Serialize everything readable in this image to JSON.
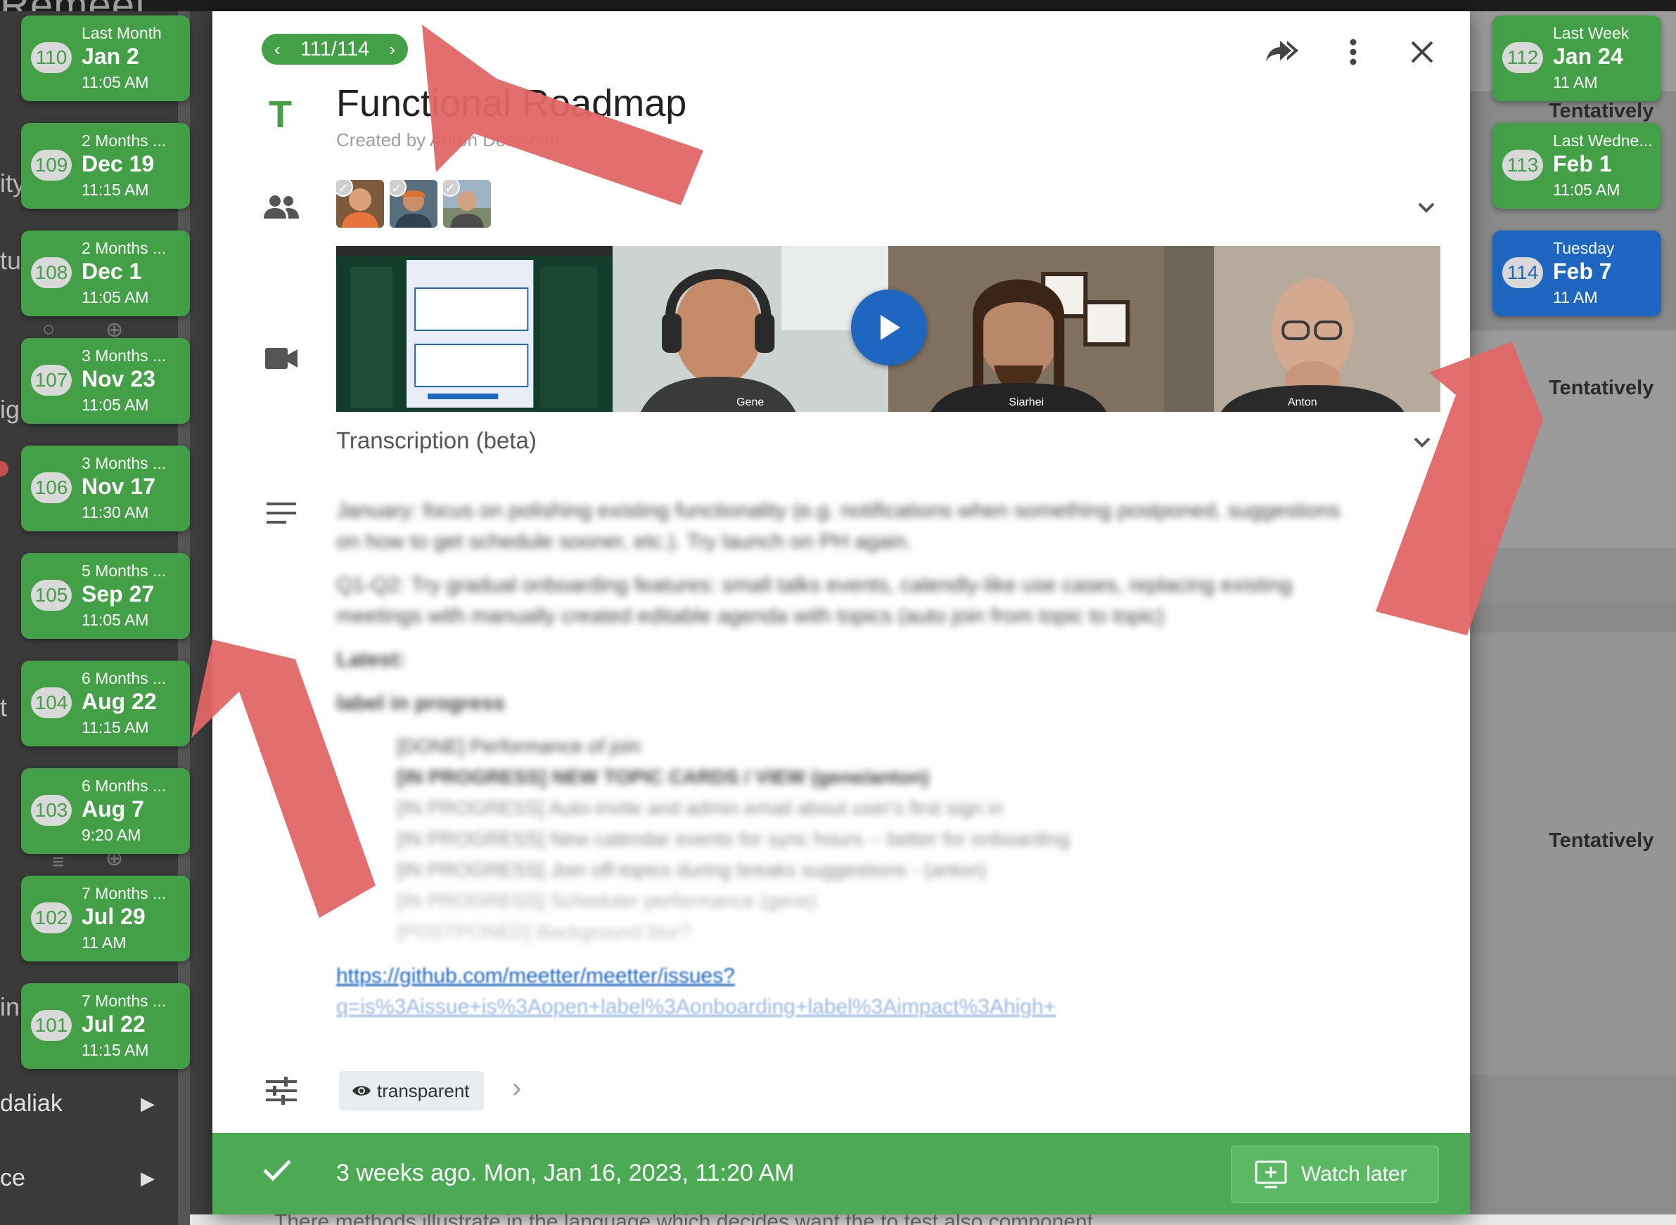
{
  "app": {
    "logo": "Remeet"
  },
  "sidebar": {
    "fragments": [
      "ity",
      "tu",
      "ig",
      "t",
      "in"
    ],
    "nav": [
      {
        "label": "daliak"
      },
      {
        "label": "ce"
      }
    ]
  },
  "timeline_left": [
    {
      "rel": "Last Month",
      "date": "Jan 2",
      "time": "11:05 AM",
      "index": "110"
    },
    {
      "rel": "2 Months ...",
      "date": "Dec 19",
      "time": "11:15 AM",
      "index": "109"
    },
    {
      "rel": "2 Months ...",
      "date": "Dec 1",
      "time": "11:05 AM",
      "index": "108"
    },
    {
      "rel": "3 Months ...",
      "date": "Nov 23",
      "time": "11:05 AM",
      "index": "107"
    },
    {
      "rel": "3 Months ...",
      "date": "Nov 17",
      "time": "11:30 AM",
      "index": "106"
    },
    {
      "rel": "5 Months ...",
      "date": "Sep 27",
      "time": "11:05 AM",
      "index": "105"
    },
    {
      "rel": "6 Months ...",
      "date": "Aug 22",
      "time": "11:15 AM",
      "index": "104"
    },
    {
      "rel": "6 Months ...",
      "date": "Aug 7",
      "time": "9:20 AM",
      "index": "103"
    },
    {
      "rel": "7 Months ...",
      "date": "Jul 29",
      "time": "11 AM",
      "index": "102"
    },
    {
      "rel": "7 Months ...",
      "date": "Jul 22",
      "time": "11:15 AM",
      "index": "101"
    }
  ],
  "timeline_right": [
    {
      "rel": "Last Week",
      "date": "Jan 24",
      "time": "11 AM",
      "index": "112"
    },
    {
      "rel": "Last Wedne...",
      "date": "Feb 1",
      "time": "11:05 AM",
      "index": "113"
    },
    {
      "rel": "Tuesday",
      "date": "Feb 7",
      "time": "11 AM",
      "index": "114"
    }
  ],
  "right_labels": {
    "tentatively": "Tentatively"
  },
  "dialog": {
    "counter": "111/114",
    "title": "Functional Roadmap",
    "created_by": "Created by Anton Dosov on",
    "participants": [
      {
        "name": "Gene"
      },
      {
        "name": "Siarhei"
      },
      {
        "name": "Anton"
      }
    ],
    "video_labels": [
      "Gene",
      "Siarhei",
      "Anton"
    ],
    "transcription_label": "Transcription (beta)",
    "notes_blurred": [
      "January: focus on polishing existing functionality (e.g. notifications when something postponed, suggestions",
      "on how to get schedule sooner, etc.). Try launch on PH again.",
      "Q1-Q2: Try gradual onboarding features: small talks events, calendly-like use cases, replacing existing",
      "meetings with manually created editable agenda with topics (auto join from topic to topic)",
      "Latest:",
      "label in progress"
    ],
    "notes_bullets": [
      "[DONE] Performance of join",
      "[IN PROGRESS] NEW TOPIC CARDS / VIEW (gene/anton)",
      "[IN PROGRESS] Auto-invite and admin email about user's first sign in",
      "[IN PROGRESS] New calendar events for sync hours -- better for onboarding",
      "[IN PROGRESS] Join off-topics during breaks suggestions - (anton)",
      "[IN PROGRESS] Scheduler performance (gene)",
      "[POSTPONED] Background blur?"
    ],
    "link_lines": [
      "https://github.com/meetter/meetter/issues?",
      "q=is%3Aissue+is%3Aopen+label%3Aonboarding+label%3Aimpact%3Ahigh+"
    ],
    "visibility_chip": "transparent",
    "footer": {
      "when": "3 weeks ago. Mon, Jan 16, 2023, 11:20 AM",
      "watch_later": "Watch later"
    }
  },
  "bottom_text": "There methods illustrate in the language which decides want the to test also component"
}
